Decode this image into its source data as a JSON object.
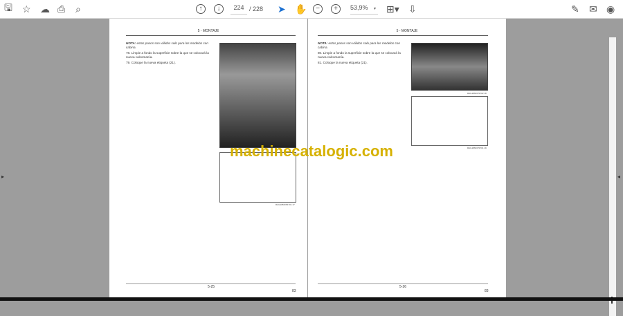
{
  "toolbar": {
    "page_current": "224",
    "page_total": "/ 228",
    "zoom": "53,9%"
  },
  "pages": [
    {
      "header": "5 - MONTAJE",
      "note_label": "NOTA:",
      "note": "estos pasos son válidos solo para los modelos con cabina.",
      "steps": [
        {
          "num": "78.",
          "text": "Limpie a fondo la superficie sobre la que se colocará la nueva calcomanía."
        },
        {
          "num": "79.",
          "text": "Coloque la nueva etiqueta (21)."
        }
      ],
      "captions": [
        "RAIL18MOP1701",
        "17"
      ],
      "footer_page": "5-25",
      "footer_code": "83"
    },
    {
      "header": "5 - MONTAJE",
      "note_label": "NOTA:",
      "note": "estos pasos son válidos solo para los modelos con cabina.",
      "steps": [
        {
          "num": "80.",
          "text": "Limpie a fondo la superficie sobre la que se colocará la nueva calcomanía."
        },
        {
          "num": "81.",
          "text": "Coloque la nueva etiqueta (21)."
        }
      ],
      "captions": [
        "RAIL18MOP1702",
        "18",
        "RAIL18MOP1701",
        "19"
      ],
      "footer_page": "5-26",
      "footer_code": "83"
    }
  ],
  "watermark": "machinecatalogic.com"
}
